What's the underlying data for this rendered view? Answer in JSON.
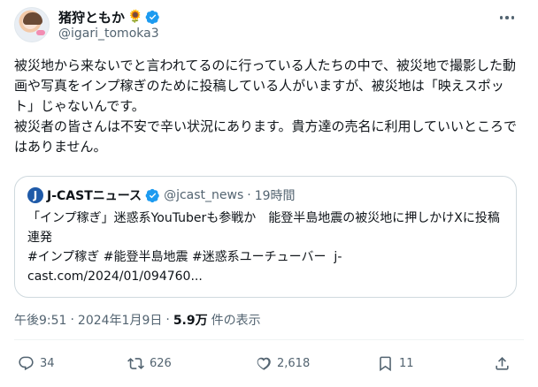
{
  "author": {
    "display_name": "猪狩ともか",
    "emoji": "🌻",
    "handle": "@igari_tomoka3"
  },
  "tweet": {
    "text": "被災地から来ないでと言われてるのに行っている人たちの中で、被災地で撮影した動画や写真をインプ稼ぎのために投稿している人がいますが、被災地は「映えスポット」じゃないんです。\n被災者の皆さんは不安で辛い状況にあります。貴方達の売名に利用していいところではありません。"
  },
  "quote": {
    "logo_letter": "J",
    "name": "J-CASTニュース",
    "handle": "@jcast_news",
    "separator": "·",
    "time": "19時間",
    "text": "「インプ稼ぎ」迷惑系YouTuberも参戦か　能登半島地震の被災地に押しかけXに投稿連発\n#インプ稼ぎ #能登半島地震 #迷惑系ユーチューバー  j-cast.com/2024/01/094760..."
  },
  "meta": {
    "time": "午後9:51",
    "separator": "·",
    "date": "2024年1月9日",
    "separator2": "·",
    "views_count": "5.9万",
    "views_label": "件の表示"
  },
  "actions": {
    "replies": "34",
    "reposts": "626",
    "likes": "2,618",
    "bookmarks": "11"
  },
  "colors": {
    "verified": "#1d9bf0",
    "secondary_text": "#536471",
    "border": "#cfd9de",
    "jcast_logo": "#1f5aa8"
  },
  "icons": [
    "more-icon",
    "verified-badge-icon",
    "reply-icon",
    "repost-icon",
    "like-icon",
    "bookmark-icon",
    "share-icon"
  ]
}
